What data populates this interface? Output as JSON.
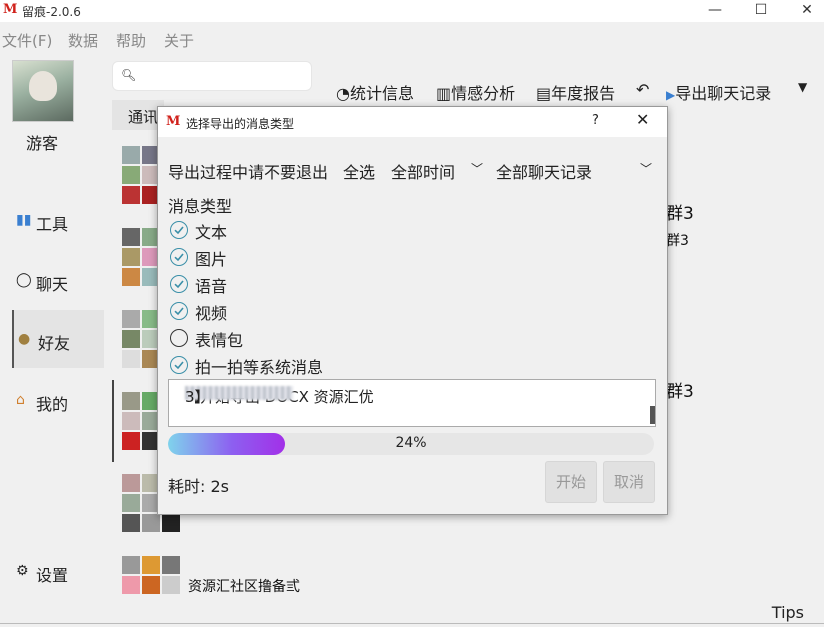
{
  "window": {
    "title": "留痕-2.0.6",
    "minimize": "—",
    "maximize": "☐",
    "close": "✕"
  },
  "menu": [
    "文件(F)",
    "数据",
    "帮助",
    "关于"
  ],
  "profile": {
    "nickname": "游客"
  },
  "nav": [
    {
      "label": "工具",
      "icon": "tools-icon"
    },
    {
      "label": "聊天",
      "icon": "chat-icon"
    },
    {
      "label": "好友",
      "icon": "contacts-icon",
      "active": true
    },
    {
      "label": "我的",
      "icon": "home-icon"
    }
  ],
  "settings": {
    "label": "设置"
  },
  "search": {
    "placeholder": ""
  },
  "toolbar": {
    "stats": "统计信息",
    "sentiment": "情感分析",
    "annual": "年度报告",
    "export": "导出聊天记录"
  },
  "tab": {
    "label": "通讯"
  },
  "list": {
    "g1": "群3",
    "g1b": "群3",
    "g2": "群3",
    "g3": "资源汇社区撸备弎"
  },
  "dialog": {
    "title": "选择导出的消息类型",
    "help": "?",
    "close": "✕",
    "hint": "导出过程中请不要退出",
    "select_all": "全选",
    "time_range": "全部时间",
    "scope": "全部聊天记录",
    "types_label": "消息类型",
    "types": [
      {
        "label": "文本",
        "checked": true
      },
      {
        "label": "图片",
        "checked": true
      },
      {
        "label": "语音",
        "checked": true
      },
      {
        "label": "视频",
        "checked": true
      },
      {
        "label": "表情包",
        "checked": false
      },
      {
        "label": "拍一拍等系统消息",
        "checked": true
      }
    ],
    "log_prefix": "【开始导出 DOCX 资源汇优",
    "log_suffix": "3】",
    "progress": 0.24,
    "progress_text": "24%",
    "elapsed": "耗时: 2s",
    "start": "开始",
    "cancel": "取消"
  },
  "tips": "Tips",
  "colors": {
    "accent": "#3a8fa8",
    "progress_start": "#7fd3ec",
    "progress_end": "#a230e8",
    "brand": "#d0201a"
  }
}
